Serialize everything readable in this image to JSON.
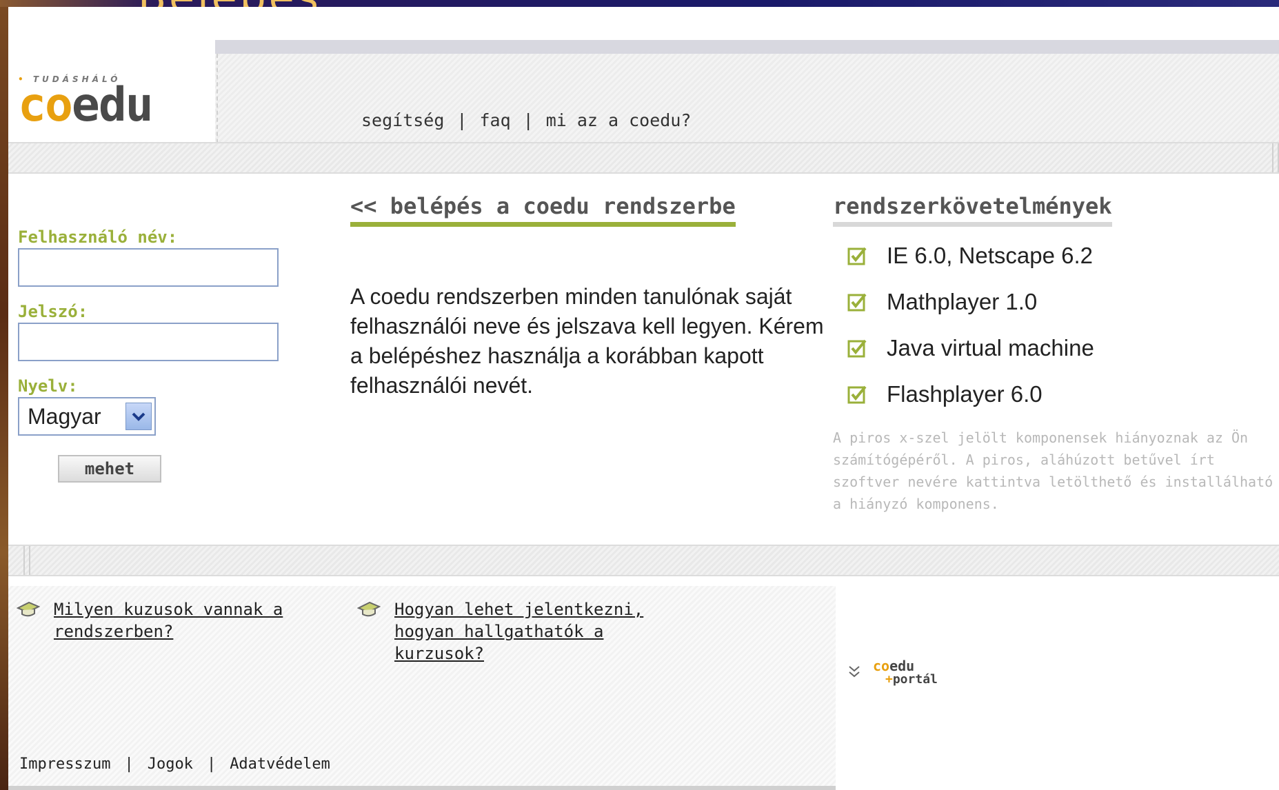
{
  "slide": {
    "title_fragment": "Belépés"
  },
  "logo": {
    "tagline": "TUDÁSHÁLÓ",
    "co": "co",
    "edu": "edu"
  },
  "topnav": {
    "items": [
      "segítség",
      "faq",
      "mi az a coedu?"
    ],
    "separator": "|"
  },
  "login": {
    "username_label": "Felhasználó név:",
    "username_value": "",
    "password_label": "Jelszó:",
    "password_value": "",
    "language_label": "Nyelv:",
    "language_selected": "Magyar",
    "submit_label": "mehet"
  },
  "main": {
    "title": "<< belépés a coedu rendszerbe",
    "text": "A coedu rendszerben minden tanulónak saját felhasználói neve és jelszava kell legyen. Kérem a belépéshez használja a korábban kapott felhasználói nevét."
  },
  "requirements": {
    "title": "rendszerkövetelmények",
    "items": [
      "IE 6.0, Netscape 6.2",
      "Mathplayer 1.0",
      "Java virtual machine",
      "Flashplayer 6.0"
    ],
    "note_lines": [
      "A piros x-szel jelölt komponensek hiányoznak az Ön",
      "számítógépéről. A piros, aláhúzott betűvel írt",
      "szoftver nevére kattintva letölthető és installálható",
      "a hiányzó komponens."
    ]
  },
  "faq": {
    "q1_line1": "Milyen kuzusok vannak a",
    "q1_line2": "rendszerben?",
    "q2_line1": "Hogyan lehet jelentkezni,",
    "q2_line2": "hogyan hallgathatók a",
    "q2_line3": "kurzusok?"
  },
  "portal": {
    "co": "co",
    "edu": "edu",
    "plus": "+",
    "word": "portál"
  },
  "footer": {
    "items": [
      "Impresszum",
      "Jogok",
      "Adatvédelem"
    ],
    "separator": "|"
  },
  "colors": {
    "accent_green": "#9ab03a",
    "logo_orange": "#e8a010",
    "field_border": "#8aa0c8"
  },
  "icons": [
    "checkbox-check-icon",
    "chevron-down-icon",
    "hat-icon",
    "double-chevron-down-icon"
  ]
}
